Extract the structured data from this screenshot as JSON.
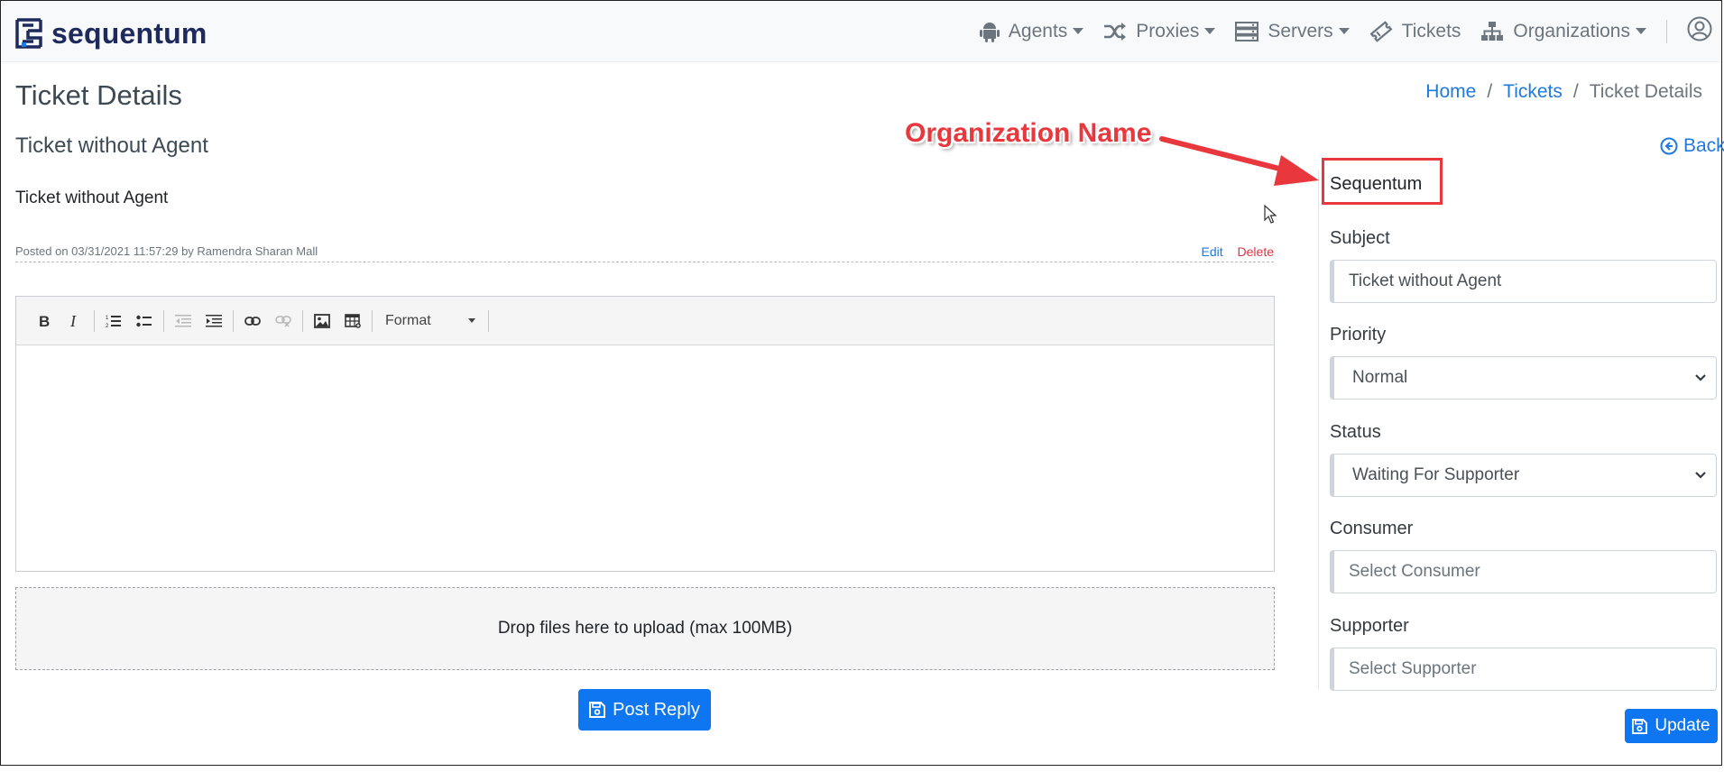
{
  "app": {
    "logo_text": "sequentum"
  },
  "nav": {
    "agents": "Agents",
    "proxies": "Proxies",
    "servers": "Servers",
    "tickets": "Tickets",
    "organizations": "Organizations"
  },
  "page": {
    "title": "Ticket Details"
  },
  "breadcrumb": {
    "home": "Home",
    "tickets": "Tickets",
    "current": "Ticket Details",
    "separator": "/"
  },
  "ticket": {
    "subject": "Ticket without Agent",
    "body": "Ticket without Agent",
    "posted": "Posted on 03/31/2021 11:57:29 by Ramendra Sharan Mall",
    "edit_label": "Edit",
    "delete_label": "Delete"
  },
  "editor": {
    "format_label": "Format"
  },
  "dropzone": {
    "text": "Drop files here to upload (max 100MB)"
  },
  "post_reply_label": "Post Reply",
  "back_label": "Back",
  "side": {
    "organization": "Sequentum",
    "subject_label": "Subject",
    "subject_value": "Ticket without Agent",
    "priority_label": "Priority",
    "priority_value": "Normal",
    "status_label": "Status",
    "status_value": "Waiting For Supporter",
    "consumer_label": "Consumer",
    "consumer_placeholder": "Select Consumer",
    "supporter_label": "Supporter",
    "supporter_placeholder": "Select Supporter",
    "update_label": "Update"
  },
  "annotation": {
    "label": "Organization Name",
    "color": "#e8383d"
  },
  "colors": {
    "primary": "#0d76f0",
    "link": "#1f7ae0",
    "danger": "#dc3545",
    "brand": "#1f2a5c"
  }
}
